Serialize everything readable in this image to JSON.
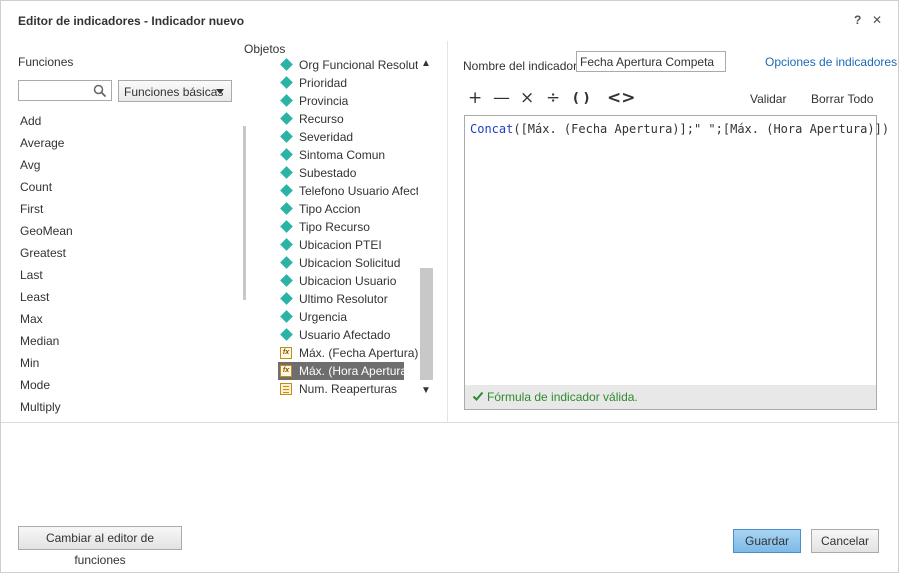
{
  "dialog": {
    "title": "Editor de indicadores - Indicador nuevo",
    "help_icon": "?",
    "close_icon": "✕"
  },
  "functions": {
    "label": "Funciones",
    "search_value": "",
    "category_selected": "Funciones básicas",
    "items": [
      "Add",
      "Average",
      "Avg",
      "Count",
      "First",
      "GeoMean",
      "Greatest",
      "Last",
      "Least",
      "Max",
      "Median",
      "Min",
      "Mode",
      "Multiply"
    ]
  },
  "objects": {
    "label": "Objetos",
    "items": [
      {
        "label": "Org Funcional Resolutor",
        "icon": "diamond"
      },
      {
        "label": "Prioridad",
        "icon": "diamond"
      },
      {
        "label": "Provincia",
        "icon": "diamond"
      },
      {
        "label": "Recurso",
        "icon": "diamond"
      },
      {
        "label": "Severidad",
        "icon": "diamond"
      },
      {
        "label": "Sintoma Comun",
        "icon": "diamond"
      },
      {
        "label": "Subestado",
        "icon": "diamond"
      },
      {
        "label": "Telefono Usuario Afectado",
        "icon": "diamond"
      },
      {
        "label": "Tipo Accion",
        "icon": "diamond"
      },
      {
        "label": "Tipo Recurso",
        "icon": "diamond"
      },
      {
        "label": "Ubicacion PTEI",
        "icon": "diamond"
      },
      {
        "label": "Ubicacion Solicitud",
        "icon": "diamond"
      },
      {
        "label": "Ubicacion Usuario",
        "icon": "diamond"
      },
      {
        "label": "Ultimo Resolutor",
        "icon": "diamond"
      },
      {
        "label": "Urgencia",
        "icon": "diamond"
      },
      {
        "label": "Usuario Afectado",
        "icon": "diamond"
      },
      {
        "label": "Máx. (Fecha Apertura)",
        "icon": "fx"
      },
      {
        "label": "Máx. (Hora Apertura)",
        "icon": "fx",
        "selected": true
      },
      {
        "label": "Num. Reaperturas",
        "icon": "measure"
      }
    ]
  },
  "editor": {
    "name_label": "Nombre del indicador:",
    "name_value": "Fecha Apertura Competa",
    "options_link": "Opciones de indicadores",
    "operators": [
      "+",
      "—",
      "×",
      "÷",
      "( )",
      "<>"
    ],
    "validate_label": "Validar",
    "clear_label": "Borrar Todo",
    "formula_fn": "Concat",
    "formula_rest": "([Máx. (Fecha Apertura)];\" \";[Máx. (Hora Apertura)])",
    "status_text": "Fórmula de indicador válida."
  },
  "footer": {
    "switch_label": "Cambiar al editor de funciones",
    "save_label": "Guardar",
    "cancel_label": "Cancelar"
  },
  "colors": {
    "accent": "#7cb9e8",
    "link": "#1a6ab5",
    "valid": "#2e8b2e",
    "object_icon": "#2bb3a5"
  }
}
